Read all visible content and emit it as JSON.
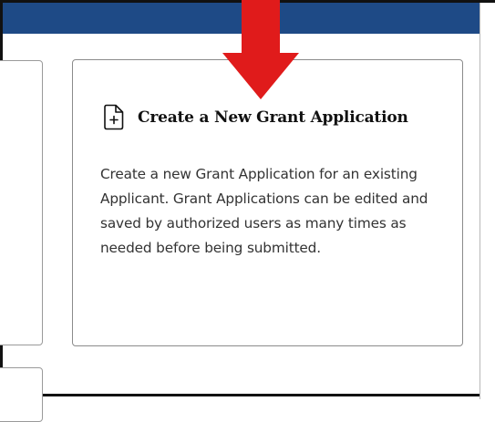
{
  "card": {
    "icon": "file-plus-icon",
    "title": "Create a New Grant Application",
    "description": "Create a new Grant Application for an existing Applicant. Grant Applications can be edited and saved by authorized users as many times as needed before being submitted."
  },
  "annotation": {
    "icon": "down-arrow-icon",
    "color": "#e01b1b"
  },
  "colors": {
    "header": "#1e4a86",
    "card_border": "#8b8b8b",
    "frame": "#111111",
    "text": "#333333"
  }
}
